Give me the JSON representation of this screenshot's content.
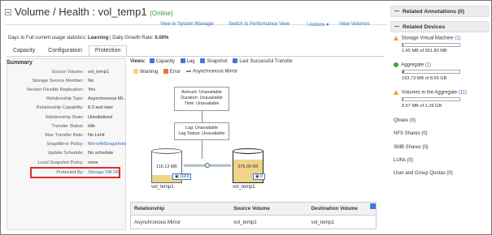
{
  "header": {
    "title": "Volume / Health : vol_temp1",
    "status": "(Online)",
    "links": {
      "system_manager": "View in System Manager",
      "performance": "Switch to Performance View",
      "actions": "Actions ▾",
      "view_volumes": "View Volumes"
    },
    "kebab": "⋮"
  },
  "stats": {
    "prefix": "Days to Full current usage statistics:",
    "learning": "Learning",
    "sep": " | Daily Growth Rate:",
    "rate": "0.00%"
  },
  "tabs": [
    "Capacity",
    "Configuration",
    "Protection"
  ],
  "summary": {
    "title": "Summary",
    "rows": [
      {
        "k": "Source Volume:",
        "v": "vol_temp1"
      },
      {
        "k": "Storage Service Member:",
        "v": "No"
      },
      {
        "k": "Version Flexible Replication:",
        "v": "Yes"
      },
      {
        "k": "Relationship Type:",
        "v": "Asynchronous Mi..."
      },
      {
        "k": "Relationship Capability:",
        "v": "8.3 and later"
      },
      {
        "k": "Relationship State:",
        "v": "Uninitialized"
      },
      {
        "k": "Transfer Status:",
        "v": "Idle"
      },
      {
        "k": "Max Transfer Rate:",
        "v": "No Limit"
      },
      {
        "k": "SnapMirror Policy:",
        "v": "MirrorAllSnapshots"
      },
      {
        "k": "Update Schedule:",
        "v": "No schedule"
      },
      {
        "k": "Local Snapshot Policy:",
        "v": "none"
      },
      {
        "k": "Protected By:",
        "v": "Storage VM DR"
      }
    ]
  },
  "views": {
    "label": "Views:",
    "items": [
      "Capacity",
      "Lag",
      "Snapshot",
      "Last Successful Transfer"
    ],
    "legend": [
      "Warning",
      "Error",
      "Asynchronous Mirror"
    ]
  },
  "colors": {
    "warning": "#f5d27a",
    "error": "#e8743b",
    "mirror": "#888888"
  },
  "topology": {
    "info1": [
      "Amount: Unavailable",
      "Duration: Unavailable",
      "Time: Unavailable"
    ],
    "info2": [
      "Lag: Unavailable",
      "Lag Status: Unavailable"
    ],
    "src": {
      "value": "116.13 MB",
      "snap": "1023",
      "name": "vol_temp1",
      "fill": 0.25
    },
    "dst": {
      "value": "376.00 KB",
      "snap": "0",
      "name": "vol_temp1",
      "fill": 0.75
    }
  },
  "table": {
    "headers": [
      "Relationship",
      "Source Volume",
      "Destination Volume"
    ],
    "rows": [
      [
        "Asynchronous Mirror",
        "vol_temp1",
        "vol_temp1"
      ]
    ]
  },
  "right": {
    "annotations": "Related Annotations (0)",
    "devices": "Related Devices",
    "svm": {
      "label": "Storage Virtual Machine",
      "count": "(1)",
      "detail": "1.45 MB of 991.80 MB",
      "fill": 0.01
    },
    "aggr": {
      "label": "Aggregate",
      "count": "(1)",
      "detail": "193.73 MB of 8.65 GB",
      "fill": 0.02
    },
    "vols": {
      "label": "Volumes in the Aggregate",
      "count": "(11)",
      "detail": "8.57 MB of 1.29 GB",
      "fill": 0.01
    },
    "qtrees": "Qtrees (0)",
    "nfs": "NFS Shares (0)",
    "smb": "SMB Shares (0)",
    "luns": "LUNs (0)",
    "quotas": "User and Group Quotas (0)"
  }
}
